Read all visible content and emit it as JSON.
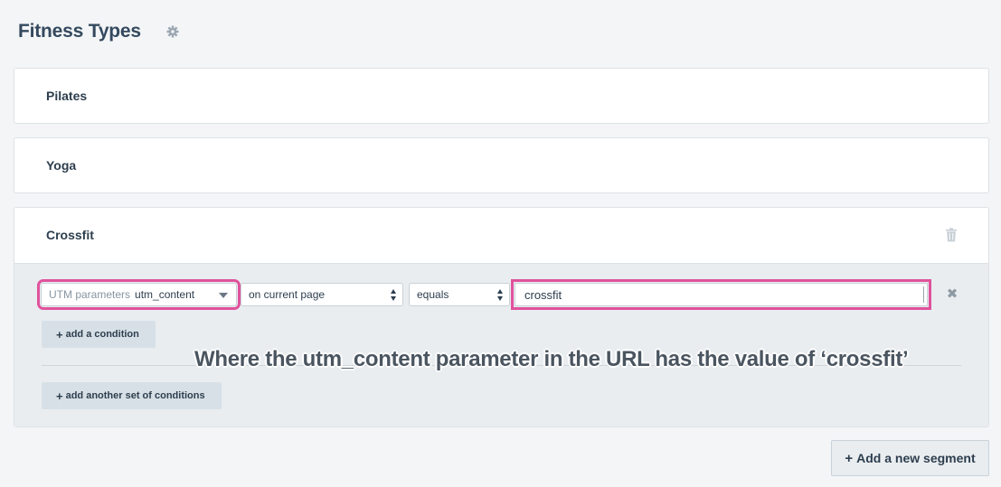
{
  "page": {
    "title": "Fitness Types"
  },
  "segments": [
    {
      "name": "Pilates"
    },
    {
      "name": "Yoga"
    },
    {
      "name": "Crossfit"
    }
  ],
  "condition": {
    "field_prefix": "UTM parameters",
    "field_value": "utm_content",
    "scope": "on current page",
    "operator": "equals",
    "value": "crossfit"
  },
  "buttons": {
    "add_condition": "add a condition",
    "add_condition_set": "add another set of conditions",
    "add_segment": "Add a new segment"
  },
  "annotation": "Where the utm_content parameter in the URL has the value of ‘crossfit’",
  "colors": {
    "highlight": "#e0529c",
    "background": "#f3f5f7",
    "conditions_bg": "#e9edf0"
  }
}
